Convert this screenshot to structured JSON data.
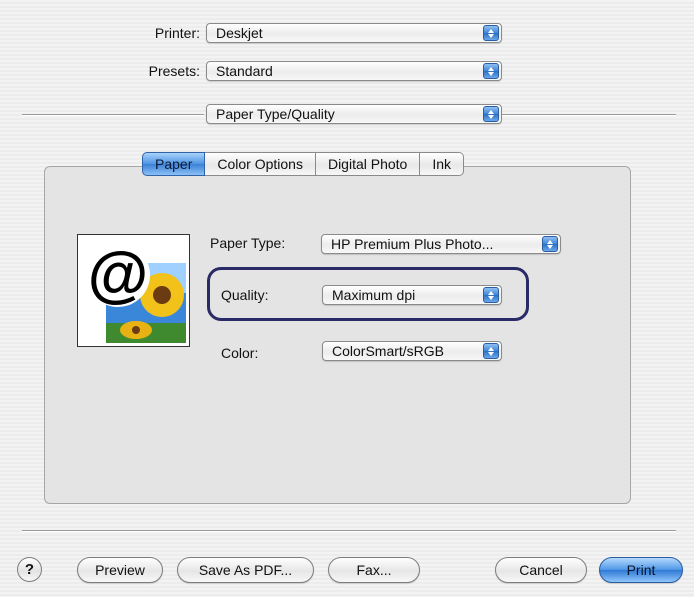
{
  "printer": {
    "label": "Printer:",
    "value": "Deskjet"
  },
  "presets": {
    "label": "Presets:",
    "value": "Standard"
  },
  "panel_select": {
    "value": "Paper Type/Quality"
  },
  "tabs": [
    {
      "label": "Paper",
      "active": true
    },
    {
      "label": "Color Options",
      "active": false
    },
    {
      "label": "Digital Photo",
      "active": false
    },
    {
      "label": "Ink",
      "active": false
    }
  ],
  "paper": {
    "preview_icon": "at-sign-sunflower-photo",
    "paper_type": {
      "label": "Paper Type:",
      "value": "HP Premium Plus Photo..."
    },
    "quality": {
      "label": "Quality:",
      "value": "Maximum dpi"
    },
    "color": {
      "label": "Color:",
      "value": "ColorSmart/sRGB"
    }
  },
  "footer": {
    "help": "?",
    "preview": "Preview",
    "save_pdf": "Save As PDF...",
    "fax": "Fax...",
    "cancel": "Cancel",
    "print": "Print"
  },
  "colors": {
    "accent_blue": "#3b81d6",
    "highlight_border": "#2a2a66"
  }
}
